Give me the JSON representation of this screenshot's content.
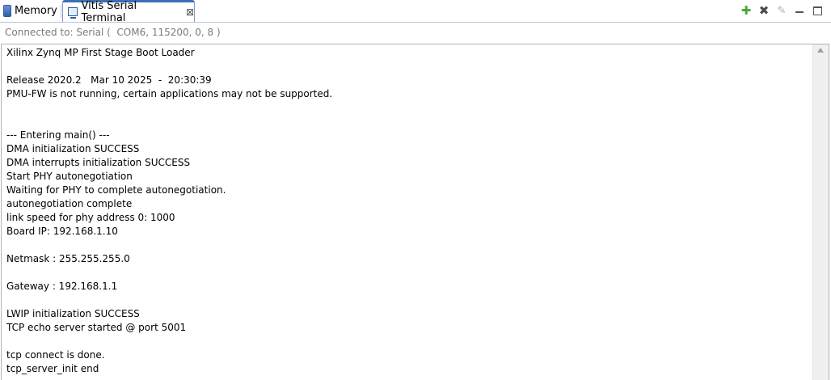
{
  "tabs": {
    "memory_label": "Memory",
    "terminal_label": "Vitis Serial Terminal",
    "close_glyph": "⊠"
  },
  "toolbar": {
    "add_icon": "add-icon",
    "remove_icon": "remove-icon",
    "clear_icon": "clear-icon",
    "minimize_icon": "minimize-icon",
    "maximize_icon": "maximize-icon"
  },
  "status": {
    "text": "Connected to: Serial (  COM6, 115200, 0, 8 )"
  },
  "console": {
    "lines": [
      "Xilinx Zynq MP First Stage Boot Loader",
      "",
      "Release 2020.2   Mar 10 2025  -  20:30:39",
      "PMU-FW is not running, certain applications may not be supported.",
      "",
      "",
      "--- Entering main() ---",
      "DMA initialization SUCCESS",
      "DMA interrupts initialization SUCCESS",
      "Start PHY autonegotiation",
      "Waiting for PHY to complete autonegotiation.",
      "autonegotiation complete",
      "link speed for phy address 0: 1000",
      "Board IP: 192.168.1.10",
      "",
      "Netmask : 255.255.255.0",
      "",
      "Gateway : 192.168.1.1",
      "",
      "LWIP initialization SUCCESS",
      "TCP echo server started @ port 5001",
      "",
      "tcp connect is done.",
      "tcp_server_init end"
    ]
  },
  "colors": {
    "active_tab_accent": "#3b6fb6",
    "add_icon": "#4aa832",
    "status_text": "#7a7a7a"
  }
}
